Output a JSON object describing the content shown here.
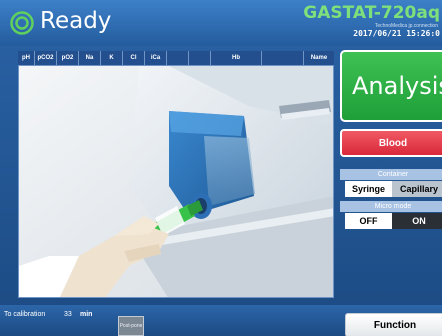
{
  "header": {
    "status": "Ready",
    "device_name": "GASTAT-720aq",
    "device_sub": "TechnoMedica jp.connection",
    "datetime": "2017/06/21 15:26:0"
  },
  "parameters": [
    "pH",
    "pCO2",
    "pO2",
    "Na",
    "K",
    "Cl",
    "iCa",
    "",
    "",
    "Hb",
    "",
    "Name"
  ],
  "right_panel": {
    "analysis_label": "Analysis",
    "sample_label": "Blood",
    "container_title": "Container",
    "container_options": [
      "Syringe",
      "Capillary"
    ],
    "container_selected": "Syringe",
    "micro_title": "Micro mode",
    "micro_options": [
      "OFF",
      "ON"
    ],
    "micro_selected": "OFF"
  },
  "bottom": {
    "calibration_label": "To calibration",
    "calibration_value": "33",
    "calibration_unit": "min",
    "postpone_label": "Post-pone",
    "function_label": "Function"
  },
  "colors": {
    "accent_green": "#2fb247",
    "accent_red": "#e23a48",
    "header_blue": "#2f6db5"
  }
}
